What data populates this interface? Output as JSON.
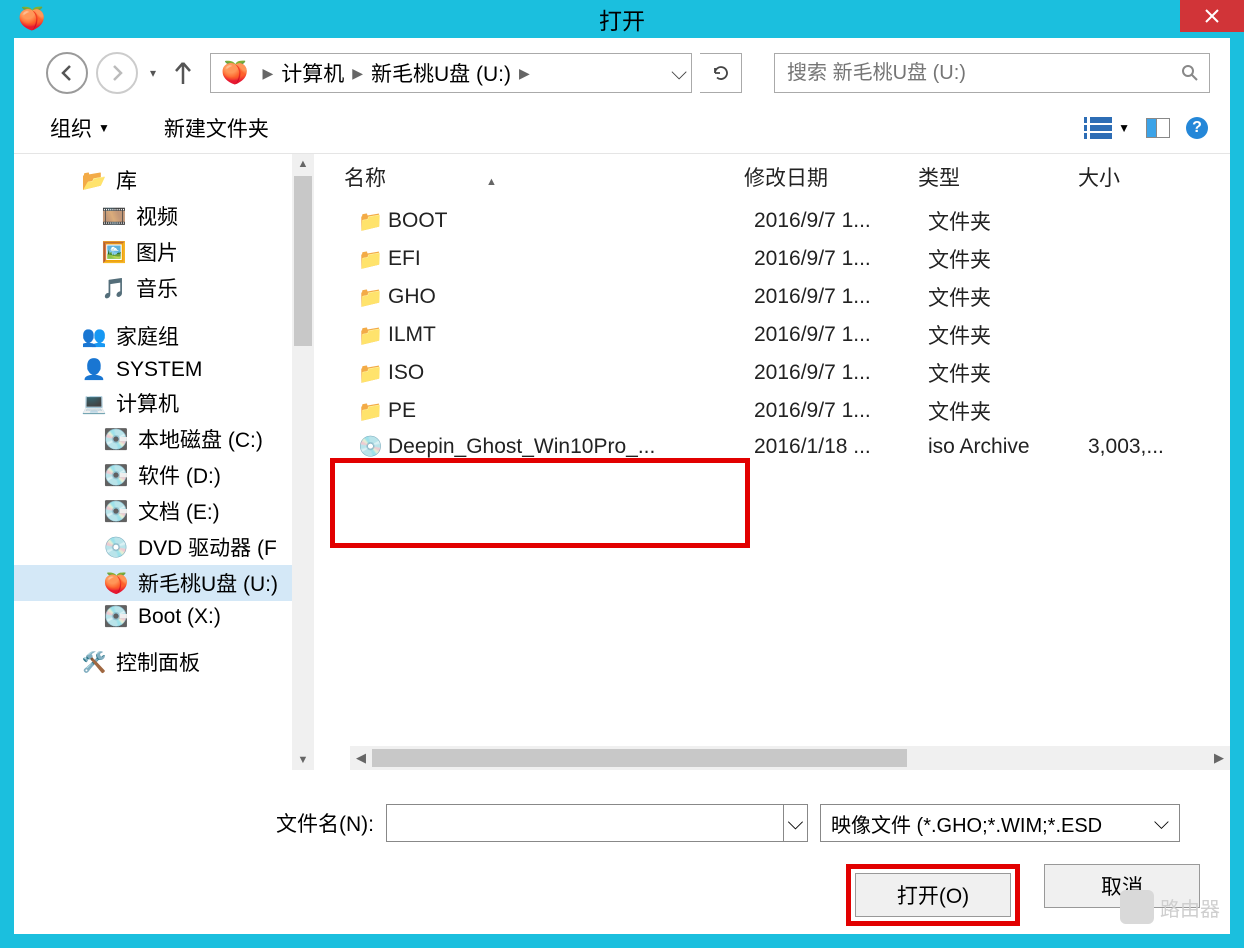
{
  "titlebar": {
    "title": "打开"
  },
  "breadcrumb": {
    "seg1": "计算机",
    "seg2": "新毛桃U盘 (U:)"
  },
  "search": {
    "placeholder": "搜索 新毛桃U盘 (U:)"
  },
  "toolbar": {
    "organize": "组织",
    "new_folder": "新建文件夹"
  },
  "headers": {
    "name": "名称",
    "date": "修改日期",
    "type": "类型",
    "size": "大小"
  },
  "sidebar": {
    "library": "库",
    "videos": "视频",
    "pictures": "图片",
    "music": "音乐",
    "homegroup": "家庭组",
    "system": "SYSTEM",
    "computer": "计算机",
    "drive_c": "本地磁盘 (C:)",
    "drive_d": "软件 (D:)",
    "drive_e": "文档 (E:)",
    "dvd": "DVD 驱动器 (F",
    "usb": "新毛桃U盘 (U:)",
    "boot": "Boot (X:)",
    "control_panel": "控制面板"
  },
  "files": [
    {
      "name": "BOOT",
      "date": "2016/9/7 1...",
      "type": "文件夹",
      "size": "",
      "icon": "folder"
    },
    {
      "name": "EFI",
      "date": "2016/9/7 1...",
      "type": "文件夹",
      "size": "",
      "icon": "folder"
    },
    {
      "name": "GHO",
      "date": "2016/9/7 1...",
      "type": "文件夹",
      "size": "",
      "icon": "folder-gho"
    },
    {
      "name": "ILMT",
      "date": "2016/9/7 1...",
      "type": "文件夹",
      "size": "",
      "icon": "folder"
    },
    {
      "name": "ISO",
      "date": "2016/9/7 1...",
      "type": "文件夹",
      "size": "",
      "icon": "folder-iso"
    },
    {
      "name": "PE",
      "date": "2016/9/7 1...",
      "type": "文件夹",
      "size": "",
      "icon": "folder"
    },
    {
      "name": "Deepin_Ghost_Win10Pro_...",
      "date": "2016/1/18 ...",
      "type": "iso Archive",
      "size": "3,003,...",
      "icon": "iso"
    }
  ],
  "filename": {
    "label": "文件名(N):"
  },
  "filetype": {
    "label": "映像文件 (*.GHO;*.WIM;*.ESD"
  },
  "buttons": {
    "open": "打开(O)",
    "cancel": "取消"
  },
  "watermark": {
    "text": "路由器"
  }
}
